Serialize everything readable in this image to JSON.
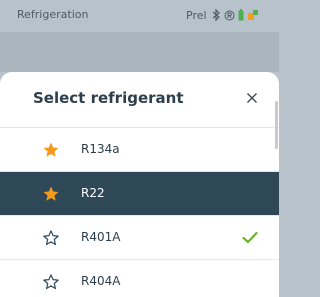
{
  "status_bar": {
    "title": "Refrigeration",
    "prel": "Prel",
    "icons": [
      "bluetooth-icon",
      "registered-icon",
      "battery-icon",
      "probe-icon"
    ]
  },
  "dialog": {
    "title": "Select refrigerant",
    "close_icon": "close-icon",
    "items": [
      {
        "label": "R134a",
        "favorite": true,
        "selected": false,
        "checked": false
      },
      {
        "label": "R22",
        "favorite": true,
        "selected": true,
        "checked": false
      },
      {
        "label": "R401A",
        "favorite": false,
        "selected": false,
        "checked": true
      },
      {
        "label": "R404A",
        "favorite": false,
        "selected": false,
        "checked": false
      }
    ]
  },
  "colors": {
    "accent": "#f39a1c",
    "selected_row": "#2f4858",
    "check": "#6ab52d",
    "status_bar": "#b8c2ca"
  }
}
